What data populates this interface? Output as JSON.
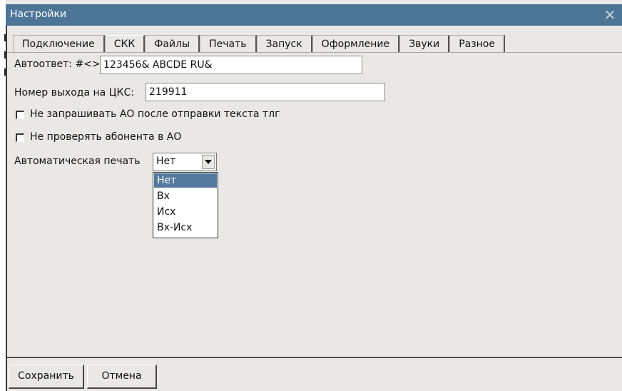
{
  "window": {
    "title": "Настройки",
    "close_icon": "close-icon"
  },
  "tabs": [
    {
      "label": "Подключение",
      "active": false
    },
    {
      "label": "СКК",
      "active": true
    },
    {
      "label": "Файлы",
      "active": false
    },
    {
      "label": "Печать",
      "active": false
    },
    {
      "label": "Запуск",
      "active": false
    },
    {
      "label": "Оформление",
      "active": false
    },
    {
      "label": "Звуки",
      "active": false
    },
    {
      "label": "Разное",
      "active": false
    }
  ],
  "form": {
    "autoreply_label": "Автоответ: #<>",
    "autoreply_value": "123456& ABCDE RU&",
    "exit_label": "Номер выхода на ЦКС:",
    "exit_value": "219911",
    "no_ask_label": "Не запрашивать АО после отправки текста тлг",
    "no_ask_checked": false,
    "no_check_label": "Не проверять абонента в АО",
    "no_check_checked": false,
    "autoprint_label": "Автоматическая печать",
    "autoprint_value": "Нет",
    "autoprint_options": [
      "Нет",
      "Вх",
      "Исх",
      "Вх-Исх"
    ]
  },
  "buttons": {
    "save": "Сохранить",
    "cancel": "Отмена"
  },
  "colors": {
    "titlebar": "#4d7598",
    "selected_option": "#55799c",
    "background": "#e9e8e6"
  }
}
